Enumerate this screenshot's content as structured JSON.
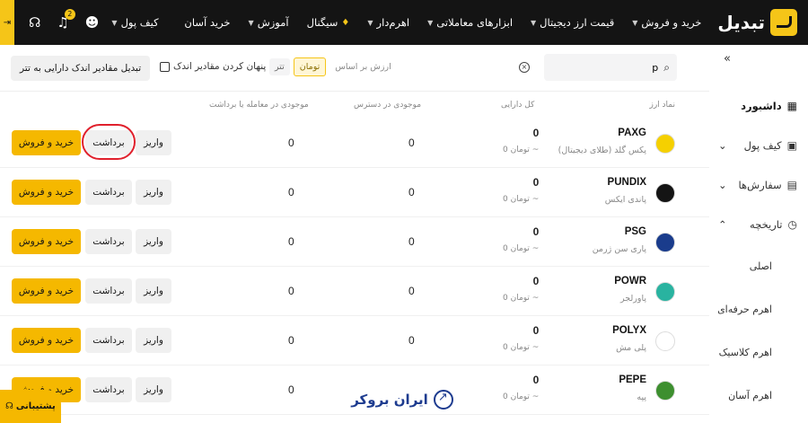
{
  "nav": {
    "logo": "تبدیل",
    "items": [
      {
        "label": "خرید و فروش",
        "chevron": true
      },
      {
        "label": "قیمت ارز دیجیتال",
        "chevron": true
      },
      {
        "label": "ابزارهای معاملاتی",
        "chevron": true
      },
      {
        "label": "اهرم‌دار",
        "chevron": true
      },
      {
        "label": "سیگنال",
        "icon": "fire-icon"
      },
      {
        "label": "آموزش",
        "chevron": true
      },
      {
        "label": "خرید آسان"
      }
    ],
    "wallet": "کیف پول",
    "notification_count": "2"
  },
  "sidebar": {
    "items": [
      {
        "label": "داشبورد",
        "icon": "dashboard-icon",
        "active": true
      },
      {
        "label": "کیف پول",
        "icon": "wallet-icon",
        "chevron": "down"
      },
      {
        "label": "سفارش‌ها",
        "icon": "orders-icon",
        "chevron": "down"
      },
      {
        "label": "تاریخچه",
        "icon": "history-icon",
        "chevron": "up"
      }
    ],
    "sub_items": [
      "اصلی",
      "اهرم حرفه‌ای",
      "اهرم کلاسیک",
      "اهرم آسان"
    ]
  },
  "filters": {
    "search_value": "p",
    "sort_label": "ارزش بر اساس",
    "sort_options": [
      "تومان",
      "تتر"
    ],
    "sort_active": "تومان",
    "hide_small": "پنهان کردن مقادیر اندک",
    "convert_button": "تبدیل مقادیر اندک دارایی به تتر"
  },
  "table": {
    "headers": {
      "symbol": "نماد ارز",
      "total": "کل دارایی",
      "available": "موجودی در دسترس",
      "ordered": "موجودی در معامله یا برداشت"
    },
    "buttons": {
      "deposit": "واریز",
      "withdraw": "برداشت",
      "trade": "خرید و فروش"
    },
    "rows": [
      {
        "symbol": "PAXG",
        "name": "پکس گلد (طلای دیجیتال)",
        "total": "0",
        "total_sub": "~ تومان 0",
        "available": "0",
        "ordered": "0",
        "icon_color": "#f5d000"
      },
      {
        "symbol": "PUNDIX",
        "name": "پاندی ایکس",
        "total": "0",
        "total_sub": "~ تومان 0",
        "available": "0",
        "ordered": "0",
        "icon_color": "#141414"
      },
      {
        "symbol": "PSG",
        "name": "پاری سن ژرمن",
        "total": "0",
        "total_sub": "~ تومان 0",
        "available": "0",
        "ordered": "0",
        "icon_color": "#1a3c8c"
      },
      {
        "symbol": "POWR",
        "name": "پاورلجر",
        "total": "0",
        "total_sub": "~ تومان 0",
        "available": "0",
        "ordered": "0",
        "icon_color": "#29b3a0"
      },
      {
        "symbol": "POLYX",
        "name": "پلی مش",
        "total": "0",
        "total_sub": "~ تومان 0",
        "available": "0",
        "ordered": "0",
        "icon_color": "#ffffff"
      },
      {
        "symbol": "PEPE",
        "name": "پپه",
        "total": "0",
        "total_sub": "~ تومان 0",
        "available": "0",
        "ordered": "0",
        "icon_color": "#3d8f2f"
      }
    ]
  },
  "support": {
    "label": "پشتیبانی"
  },
  "watermark": {
    "text": "ایران بروکر"
  }
}
